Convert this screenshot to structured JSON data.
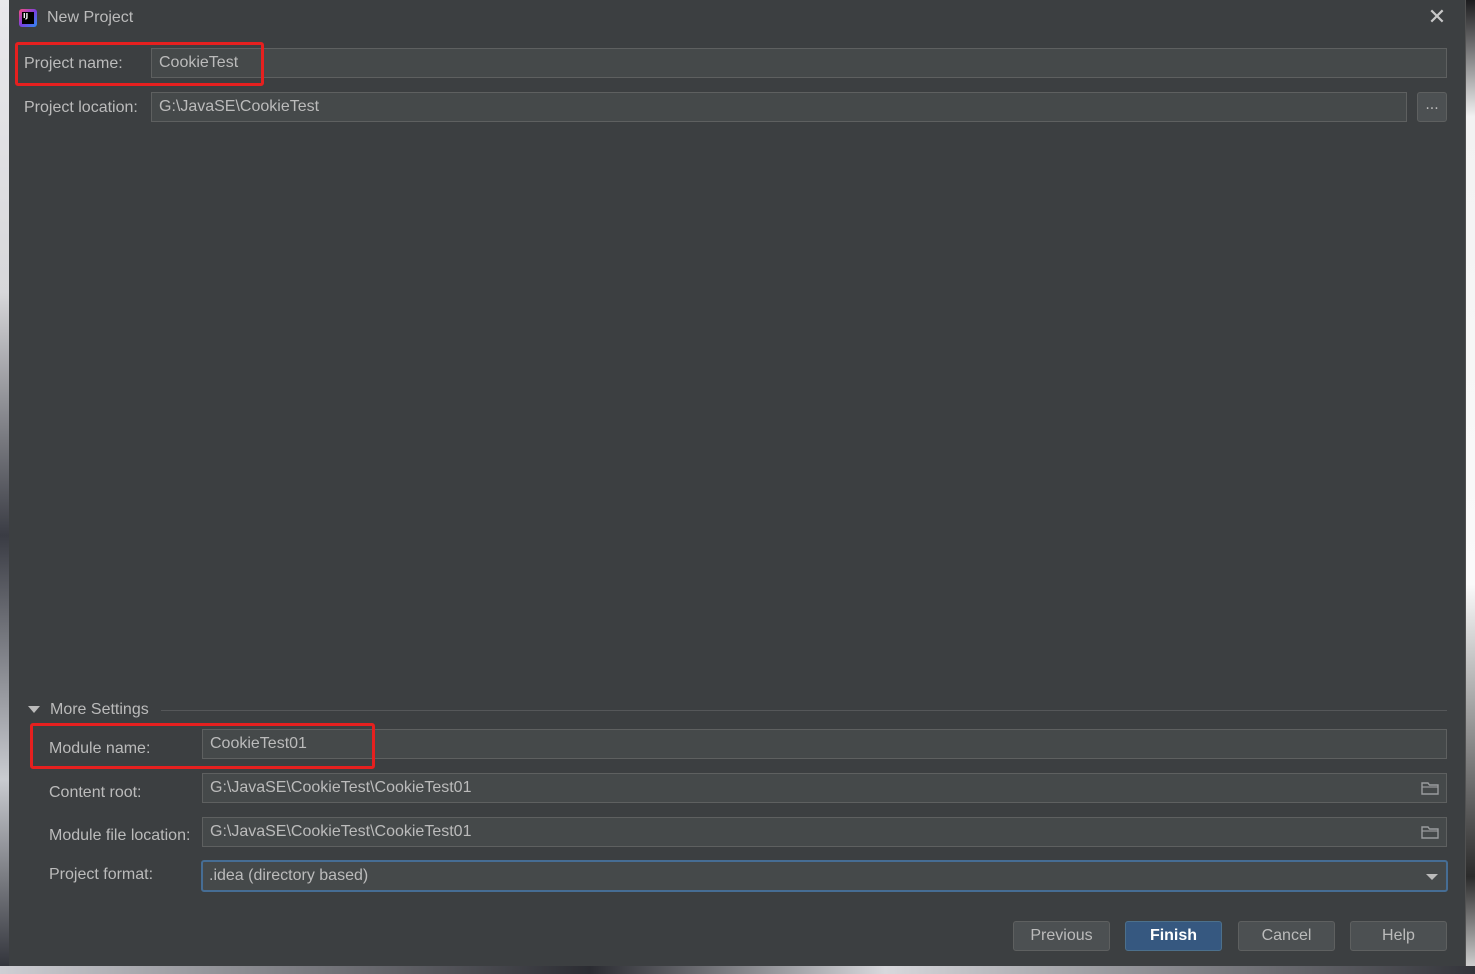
{
  "window": {
    "title": "New Project",
    "app_icon": "intellij-idea-icon",
    "close_icon": "close-icon"
  },
  "project": {
    "name_label": "Project name:",
    "name_value": "CookieTest",
    "location_label": "Project location:",
    "location_value": "G:\\JavaSE\\CookieTest",
    "browse_label": "..."
  },
  "more_settings": {
    "header": "More Settings",
    "expanded": true,
    "module_name_label": "Module name:",
    "module_name_value": "CookieTest01",
    "content_root_label": "Content root:",
    "content_root_value": "G:\\JavaSE\\CookieTest\\CookieTest01",
    "module_file_label": "Module file location:",
    "module_file_value": "G:\\JavaSE\\CookieTest\\CookieTest01",
    "format_label": "Project format:",
    "format_value": ".idea (directory based)"
  },
  "buttons": {
    "previous": "Previous",
    "finish": "Finish",
    "cancel": "Cancel",
    "help": "Help"
  },
  "colors": {
    "dialog_bg": "#3c3f41",
    "field_bg": "#45494a",
    "highlight": "#e6201f",
    "primary_button": "#365880",
    "focus_border": "#466d94"
  }
}
